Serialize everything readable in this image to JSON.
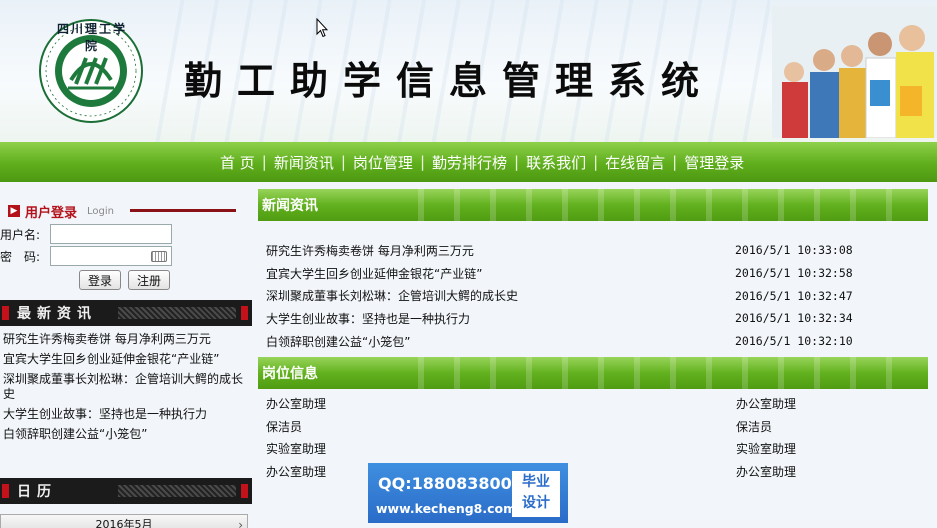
{
  "header": {
    "title": "勤工助学信息管理系统",
    "logo_text": "四川理工学院"
  },
  "nav": {
    "items": [
      "首 页",
      "新闻资讯",
      "岗位管理",
      "勤劳排行榜",
      "联系我们",
      "在线留言",
      "管理登录"
    ]
  },
  "login": {
    "title": "用户登录",
    "subtitle": "Login",
    "username_label": "用户名:",
    "password_label": "密　码:",
    "username_value": "",
    "password_value": "",
    "login_button": "登录",
    "register_button": "注册"
  },
  "left_news": {
    "title": "最新资讯",
    "items": [
      "研究生许秀梅卖卷饼 每月净利两三万元",
      "宜宾大学生回乡创业延伸金银花“产业链”",
      "深圳聚成董事长刘松琳：企管培训大鳄的成长史",
      "大学生创业故事：坚持也是一种执行力",
      "白领辞职创建公益“小笼包”"
    ]
  },
  "calendar": {
    "title": "日历",
    "month": "2016年5月",
    "next": "›"
  },
  "news_section": {
    "title": "新闻资讯",
    "rows": [
      {
        "title": "研究生许秀梅卖卷饼 每月净利两三万元",
        "date": "2016/5/1 10:33:08"
      },
      {
        "title": "宜宾大学生回乡创业延伸金银花“产业链”",
        "date": "2016/5/1 10:32:58"
      },
      {
        "title": "深圳聚成董事长刘松琳：企管培训大鳄的成长史",
        "date": "2016/5/1 10:32:47"
      },
      {
        "title": "大学生创业故事：坚持也是一种执行力",
        "date": "2016/5/1 10:32:34"
      },
      {
        "title": "白领辞职创建公益“小笼包”",
        "date": "2016/5/1 10:32:10"
      }
    ]
  },
  "jobs_section": {
    "title": "岗位信息",
    "rows": [
      {
        "left": "办公室助理",
        "right": "办公室助理"
      },
      {
        "left": "保洁员",
        "right": "保洁员"
      },
      {
        "left": "实验室助理",
        "right": "实验室助理"
      },
      {
        "left": "办公室助理",
        "right": "办公室助理"
      }
    ]
  },
  "watermark": {
    "qq": "QQ:188083800",
    "url": "www.kecheng8.com",
    "badge_line1": "毕业",
    "badge_line2": "设计"
  },
  "colors": {
    "nav_green": "#5fae1d",
    "accent_red": "#b4121a",
    "dark_bar": "#1b1b1b",
    "watermark_blue": "#2a6cc8"
  }
}
